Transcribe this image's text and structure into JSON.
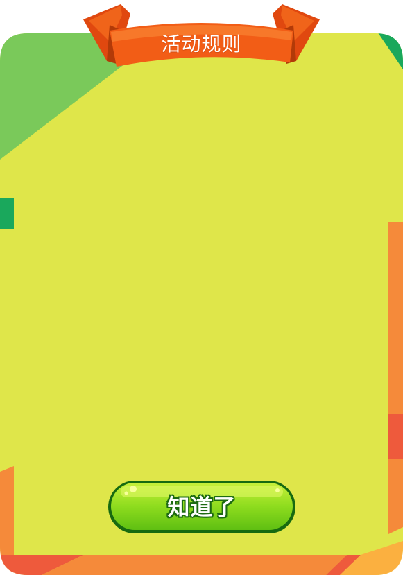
{
  "dialog": {
    "title": "活动规则",
    "confirm_label": "知道了",
    "rules_text": ""
  },
  "colors": {
    "border_green": "#7ac95a",
    "border_yellow": "#dfe64a",
    "border_dark_green": "#1aa85c",
    "border_orange": "#f58a3a",
    "border_red": "#ee5a3c",
    "ribbon_orange": "#f46418",
    "button_green": "#86d61a",
    "button_outline": "#176a10"
  }
}
